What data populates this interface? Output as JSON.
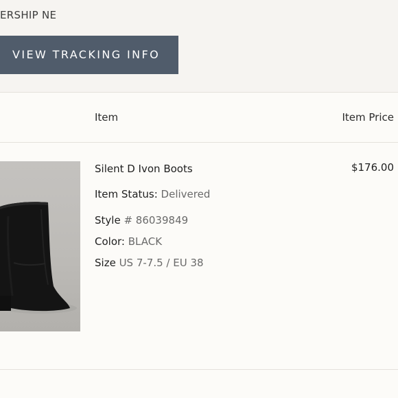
{
  "order": {
    "address_fragment": "ERSHIP NE",
    "track_button_label": "VIEW TRACKING INFO"
  },
  "table": {
    "headers": {
      "item": "Item",
      "item_price": "Item Price"
    }
  },
  "line_item": {
    "name": "Silent D Ivon Boots",
    "price": "$176.00",
    "status_label": "Item Status:",
    "status_value": "Delivered",
    "style_label": "Style",
    "style_value": "# 86039849",
    "color_label": "Color:",
    "color_value": "BLACK",
    "size_label": "Size",
    "size_value": "US 7-7.5 / EU 38",
    "image_subject": "black-suede-ankle-boot"
  },
  "colors": {
    "button_bg": "#505c6b",
    "page_bg": "#f6f4f1",
    "card_bg": "#fcfbf8",
    "muted_text": "#6a6a6a"
  }
}
